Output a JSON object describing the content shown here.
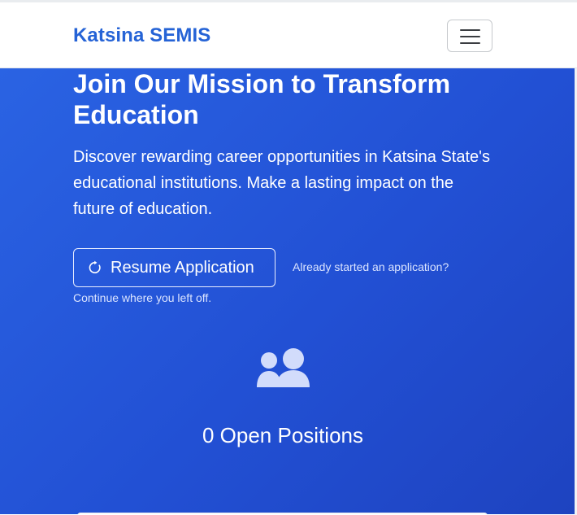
{
  "navbar": {
    "brand": "Katsina SEMIS",
    "menu_icon": "hamburger-menu-icon"
  },
  "hero": {
    "title": "Join Our Mission to Transform Education",
    "subtitle": "Discover rewarding career opportunities in Katsina State's educational institutions. Make a lasting impact on the future of education.",
    "resume_button": {
      "label": "Resume Application",
      "icon": "refresh-icon"
    },
    "already_started": "Already started an application?",
    "continue_text": "Continue where you left off.",
    "positions_icon": "users-icon",
    "open_positions": "0 Open Positions"
  },
  "colors": {
    "brand": "#2563d6",
    "hero_gradient_start": "#2a63e3",
    "hero_gradient_end": "#1e43c0"
  }
}
